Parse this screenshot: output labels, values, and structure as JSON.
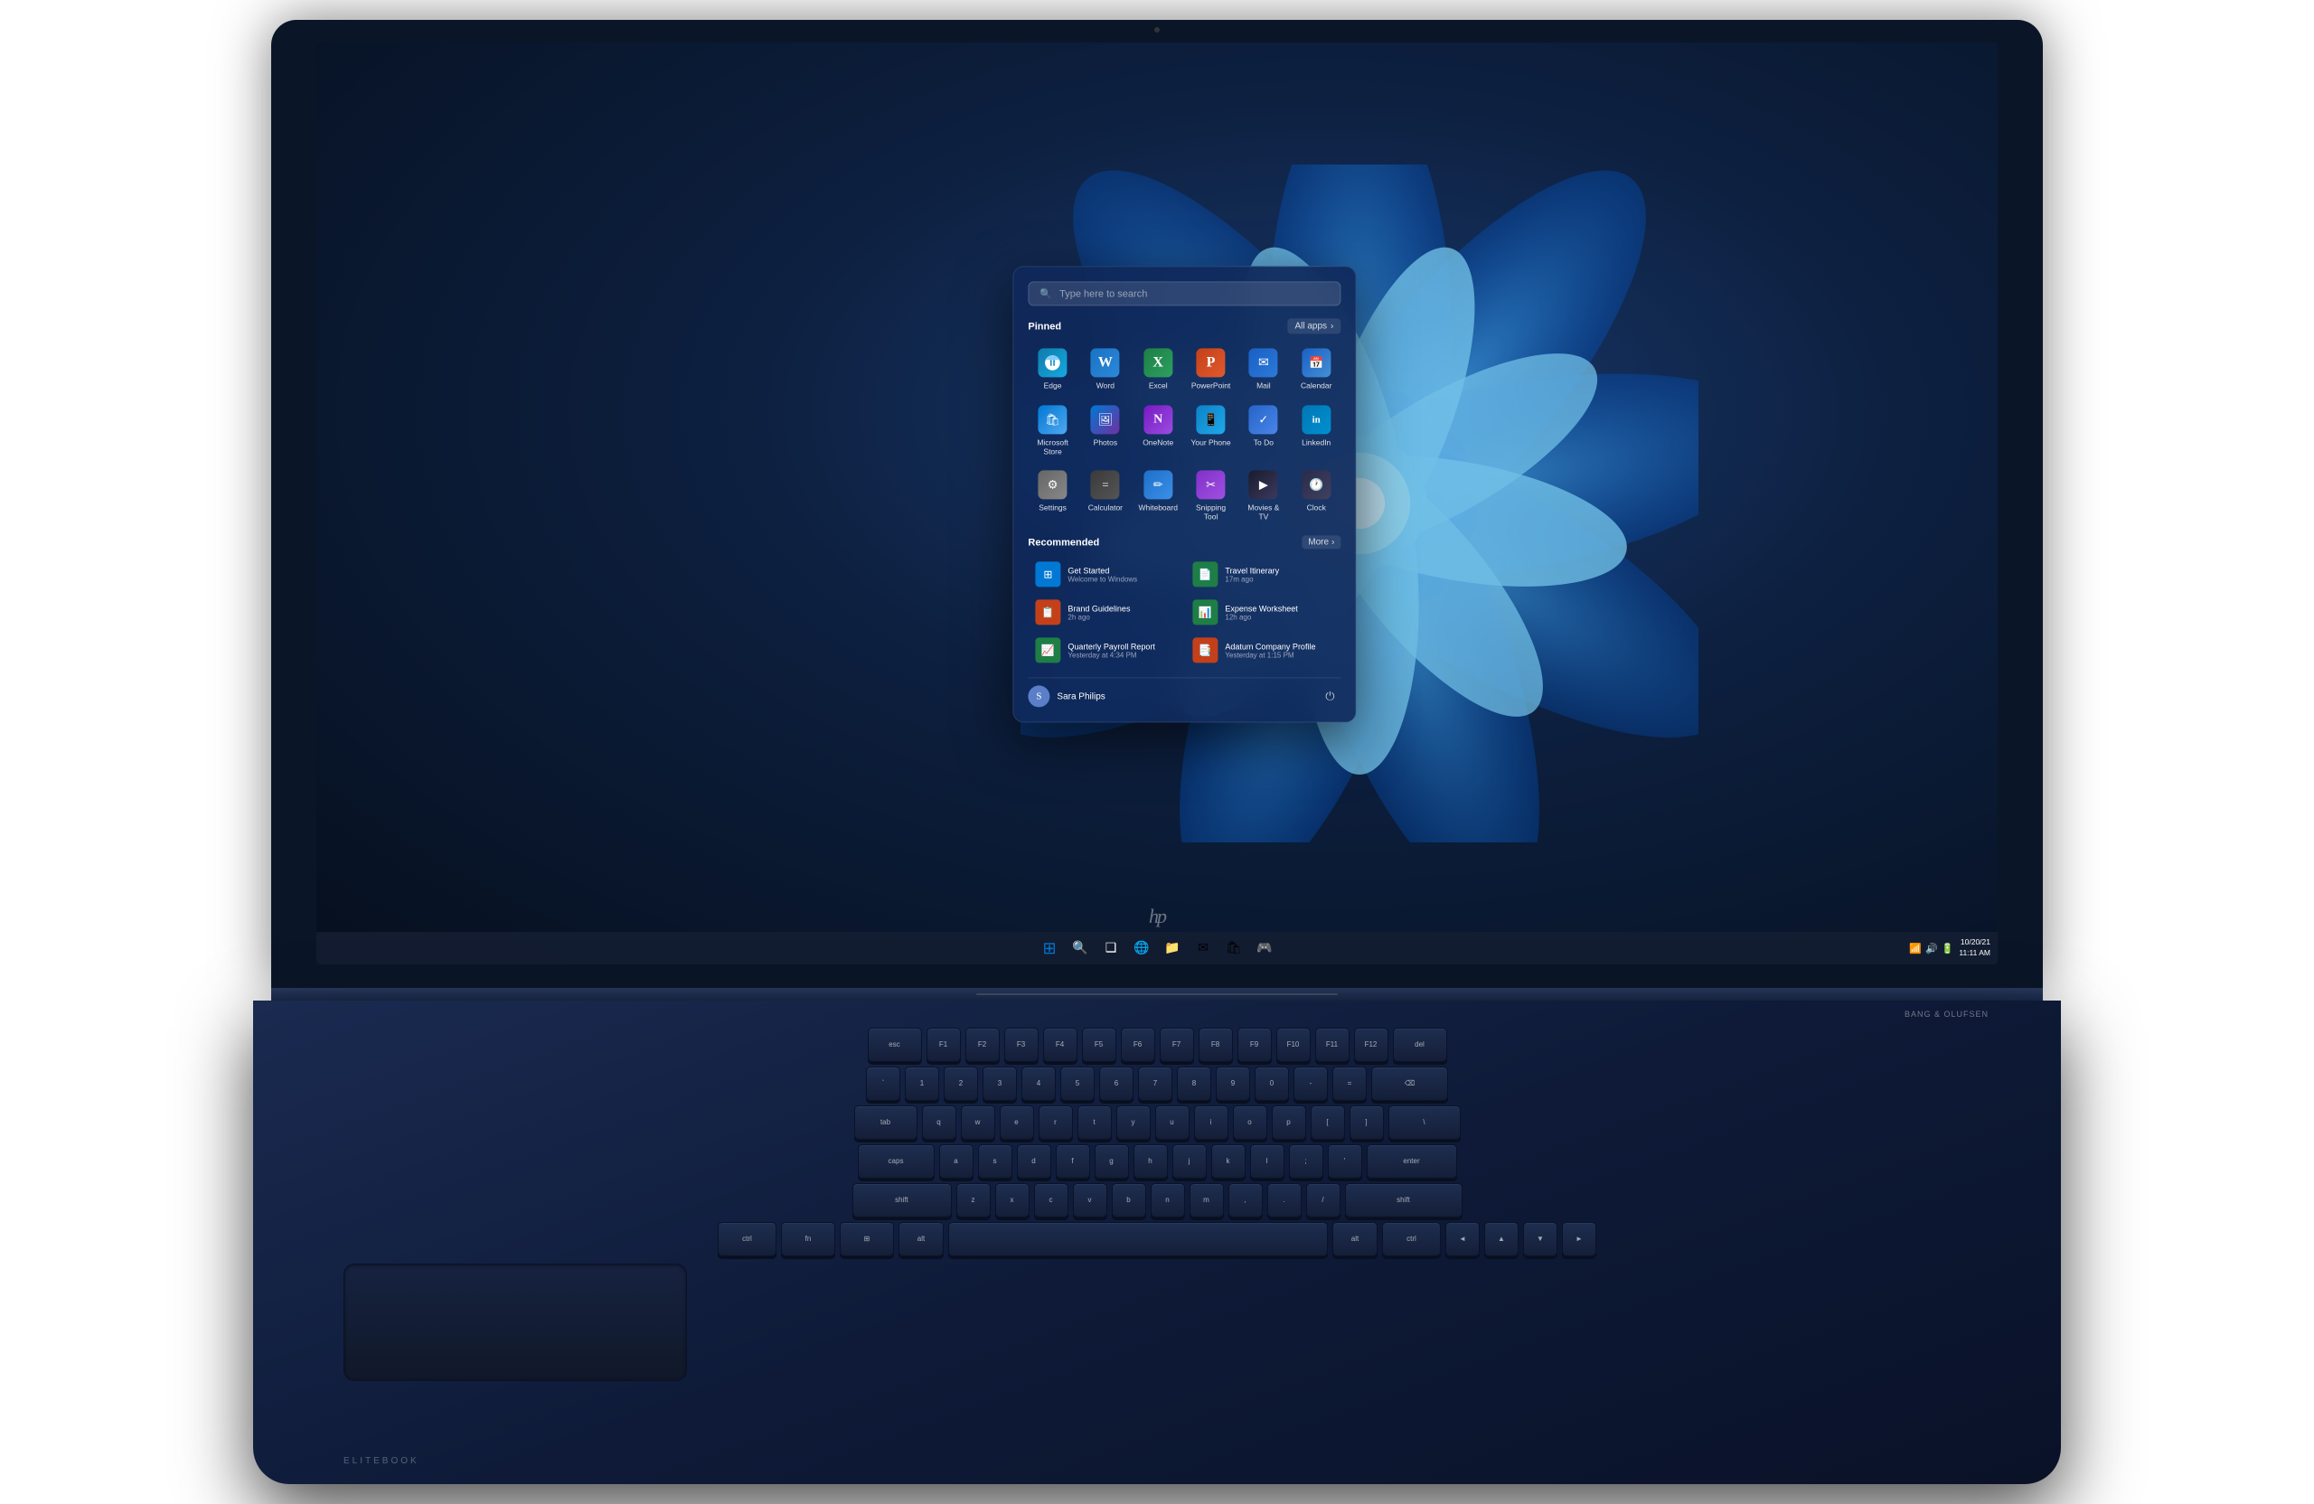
{
  "laptop": {
    "brand": "hp",
    "model": "EliteBook",
    "audio": "BANG & OLUFSEN"
  },
  "screen": {
    "background_gradient": "radial-gradient(ellipse at 60% 40%, #1a3a6e 0%, #0d2040 40%, #060f1e 100%)"
  },
  "start_menu": {
    "search_placeholder": "Type here to search",
    "pinned_label": "Pinned",
    "all_apps_label": "All apps",
    "all_apps_arrow": "›",
    "apps": [
      {
        "id": "edge",
        "label": "Edge",
        "icon_class": "icon-edge",
        "icon_char": "🌐"
      },
      {
        "id": "word",
        "label": "Word",
        "icon_class": "icon-word",
        "icon_char": "W"
      },
      {
        "id": "excel",
        "label": "Excel",
        "icon_class": "icon-excel",
        "icon_char": "X"
      },
      {
        "id": "powerpoint",
        "label": "PowerPoint",
        "icon_class": "icon-powerpoint",
        "icon_char": "P"
      },
      {
        "id": "mail",
        "label": "Mail",
        "icon_class": "icon-mail",
        "icon_char": "✉"
      },
      {
        "id": "calendar",
        "label": "Calendar",
        "icon_class": "icon-calendar",
        "icon_char": "📅"
      },
      {
        "id": "store",
        "label": "Microsoft Store",
        "icon_class": "icon-store",
        "icon_char": "🛍"
      },
      {
        "id": "photos",
        "label": "Photos",
        "icon_class": "icon-photos",
        "icon_char": "🖼"
      },
      {
        "id": "onenote",
        "label": "OneNote",
        "icon_class": "icon-onenote",
        "icon_char": "N"
      },
      {
        "id": "yourphone",
        "label": "Your Phone",
        "icon_class": "icon-yourphone",
        "icon_char": "📱"
      },
      {
        "id": "todo",
        "label": "To Do",
        "icon_class": "icon-todo",
        "icon_char": "✓"
      },
      {
        "id": "linkedin",
        "label": "LinkedIn",
        "icon_class": "icon-linkedin",
        "icon_char": "in"
      },
      {
        "id": "settings",
        "label": "Settings",
        "icon_class": "icon-settings",
        "icon_char": "⚙"
      },
      {
        "id": "calculator",
        "label": "Calculator",
        "icon_class": "icon-calculator",
        "icon_char": "="
      },
      {
        "id": "whiteboard",
        "label": "Whiteboard",
        "icon_class": "icon-whiteboard",
        "icon_char": "✏"
      },
      {
        "id": "snipping",
        "label": "Snipping Tool",
        "icon_class": "icon-snipping",
        "icon_char": "✂"
      },
      {
        "id": "movies",
        "label": "Movies & TV",
        "icon_class": "icon-movies",
        "icon_char": "▶"
      },
      {
        "id": "clock",
        "label": "Clock",
        "icon_class": "icon-clock",
        "icon_char": "🕐"
      }
    ],
    "recommended_label": "Recommended",
    "more_label": "More",
    "more_arrow": "›",
    "recommended_items": [
      {
        "id": "get-started",
        "name": "Get Started",
        "time": "Welcome to Windows",
        "icon_char": "⊞",
        "icon_bg": "#0078d4"
      },
      {
        "id": "travel-itinerary",
        "name": "Travel Itinerary",
        "time": "17m ago",
        "icon_char": "📄",
        "icon_bg": "#1e7e45"
      },
      {
        "id": "brand-guidelines",
        "name": "Brand Guidelines",
        "time": "2h ago",
        "icon_char": "📋",
        "icon_bg": "#c4401a"
      },
      {
        "id": "expense-worksheet",
        "name": "Expense Worksheet",
        "time": "12h ago",
        "icon_char": "📊",
        "icon_bg": "#1a5fc4"
      },
      {
        "id": "quarterly-payroll",
        "name": "Quarterly Payroll Report",
        "time": "Yesterday at 4:34 PM",
        "icon_char": "📈",
        "icon_bg": "#1e7e45"
      },
      {
        "id": "adatum-company",
        "name": "Adatum Company Profile",
        "time": "Yesterday at 1:15 PM",
        "icon_char": "📑",
        "icon_bg": "#c4401a"
      }
    ],
    "user": {
      "name": "Sara Philips",
      "avatar_char": "S"
    },
    "power_icon": "⏻"
  },
  "taskbar": {
    "start_icon": "⊞",
    "search_icon": "🔍",
    "task_view_icon": "❑",
    "edge_icon": "🌐",
    "file_explorer_icon": "📁",
    "mail_icon": "✉",
    "store_icon": "🛍",
    "xbox_icon": "🎮",
    "system_tray": {
      "wifi_icon": "📶",
      "volume_icon": "🔊",
      "battery_icon": "🔋",
      "date": "10/20/21",
      "time": "11:11 AM"
    }
  },
  "keyboard": {
    "rows": [
      [
        "esc",
        "F1",
        "F2",
        "F3",
        "F4",
        "F5",
        "F6",
        "F7",
        "F8",
        "F9",
        "F10",
        "F11",
        "F12",
        "del"
      ],
      [
        "`",
        "1",
        "2",
        "3",
        "4",
        "5",
        "6",
        "7",
        "8",
        "9",
        "0",
        "-",
        "=",
        "⌫"
      ],
      [
        "tab",
        "q",
        "w",
        "e",
        "r",
        "t",
        "y",
        "u",
        "i",
        "o",
        "p",
        "[",
        "]",
        "\\"
      ],
      [
        "caps",
        "a",
        "s",
        "d",
        "f",
        "g",
        "h",
        "j",
        "k",
        "l",
        ";",
        "'",
        "enter"
      ],
      [
        "shift",
        "z",
        "x",
        "c",
        "v",
        "b",
        "n",
        "m",
        ",",
        ".",
        "/",
        "shift"
      ],
      [
        "ctrl",
        "fn",
        "win",
        "alt",
        "space",
        "alt",
        "ctrl",
        "◄",
        "▲",
        "▼",
        "►"
      ]
    ]
  }
}
